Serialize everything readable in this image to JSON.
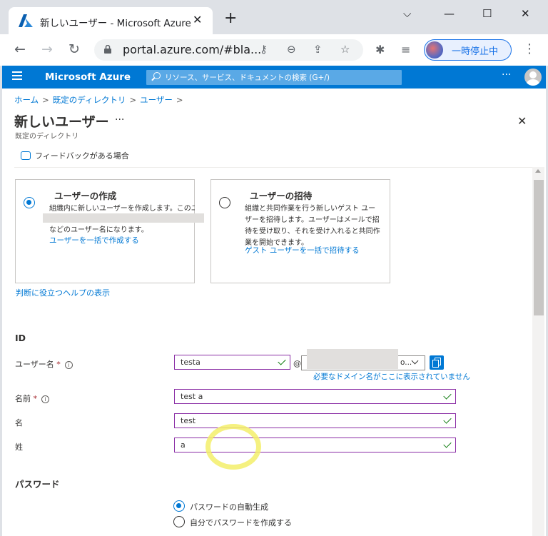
{
  "browser": {
    "tab_title": "新しいユーザー - Microsoft Azure",
    "tab_close": "✕",
    "new_tab": "+",
    "window_controls": [
      "⌵",
      "—",
      "☐",
      "✕"
    ],
    "url": "portal.azure.com/#bla...",
    "profile_label": "一時停止中",
    "icons": [
      "back-icon",
      "forward-icon",
      "reload-icon",
      "lock-icon",
      "key-icon",
      "zoom-icon",
      "share-icon",
      "star-icon",
      "extensions-icon",
      "media-icon",
      "menu-icon"
    ]
  },
  "azure": {
    "brand": "Microsoft Azure",
    "search_placeholder": "リソース、サービス、ドキュメントの検索 (G+/)",
    "more": "···"
  },
  "page": {
    "breadcrumb": [
      "ホーム",
      "既定のディレクトリ",
      "ユーザー"
    ],
    "breadcrumb_sep": ">",
    "title": "新しいユーザー",
    "title_more": "···",
    "subtitle": "既定のディレクトリ",
    "close": "✕",
    "feedback": "フィードバックがある場合"
  },
  "options": {
    "create": {
      "title": "ユーザーの作成",
      "desc_line1": "組織内に新しいユーザーを作成します。このユー",
      "desc_line2": "などのユーザー名になります。",
      "link": "ユーザーを一括で作成する",
      "selected": true
    },
    "invite": {
      "title": "ユーザーの招待",
      "desc": "組織と共同作業を行う新しいゲスト ユーザーを招待します。ユーザーはメールで招待を受け取り、それを受け入れると共同作業を開始できます。",
      "link": "ゲスト ユーザーを一括で招待する",
      "selected": false
    },
    "help_link": "判断に役立つヘルプの表示"
  },
  "identity": {
    "heading": "ID",
    "username_label": "ユーザー名",
    "username_value": "testa",
    "at": "@",
    "domain_suffix": "o...",
    "domain_hint": "必要なドメイン名がここに表示されていません",
    "name_label": "名前",
    "name_value": "test a",
    "first_label": "名",
    "first_value": "test",
    "last_label": "姓",
    "last_value": "a",
    "required_mark": "*",
    "info": "i"
  },
  "password": {
    "heading": "パスワード",
    "auto_label": "パスワードの自動生成",
    "manual_label": "自分でパスワードを作成する",
    "selected": "auto"
  },
  "colors": {
    "azure_blue": "#0078d4",
    "field_border": "#8a2da5",
    "valid_green": "#107c10"
  }
}
